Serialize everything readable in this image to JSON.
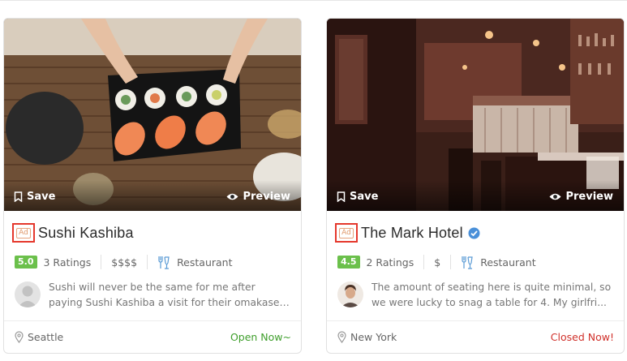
{
  "colors": {
    "rating_badge": "#6bc04b",
    "open_status": "#3e9e2b",
    "closed_status": "#d0302a",
    "highlight_box": "#e5382d",
    "verified": "#4a90d9"
  },
  "actions": {
    "save_label": "Save",
    "preview_label": "Preview"
  },
  "listings": [
    {
      "ad_label": "Ad",
      "name": "Sushi Kashiba",
      "verified": false,
      "rating": "5.0",
      "ratings_count": "3 Ratings",
      "price": "$$$$",
      "category": "Restaurant",
      "review_text": "Sushi will never be the same for me after paying Sushi Kashiba a visit for their omakase. The S...",
      "location": "Seattle",
      "status": "Open Now~",
      "status_type": "open",
      "icons": [
        "bookmark-icon",
        "eye-icon",
        "restaurant-icon",
        "location-pin-icon"
      ]
    },
    {
      "ad_label": "Ad",
      "name": "The Mark Hotel",
      "verified": true,
      "rating": "4.5",
      "ratings_count": "2 Ratings",
      "price": "$",
      "category": "Restaurant",
      "review_text": "The amount of seating here is quite minimal, so we were lucky to snag a table for 4. My girlfri...",
      "location": "New York",
      "status": "Closed Now!",
      "status_type": "closed",
      "icons": [
        "bookmark-icon",
        "eye-icon",
        "verified-check-icon",
        "restaurant-icon",
        "location-pin-icon"
      ]
    }
  ]
}
